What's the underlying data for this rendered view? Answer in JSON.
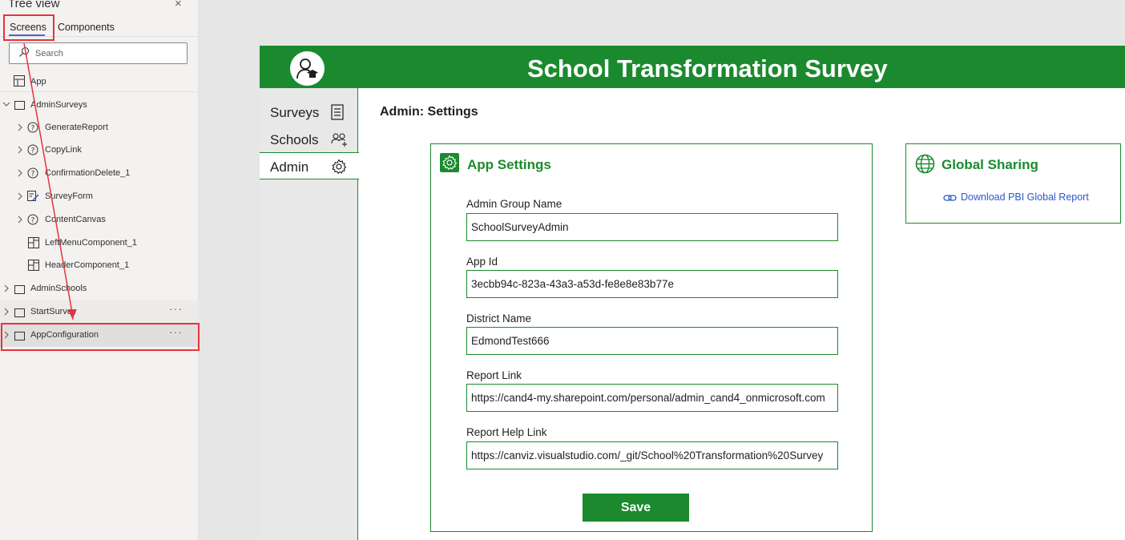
{
  "tree_view": {
    "title": "Tree view",
    "close_glyph": "×",
    "tabs": {
      "screens": "Screens",
      "components": "Components"
    },
    "search_placeholder": "Search",
    "app_item": "App",
    "items": [
      {
        "label": "AdminSurveys",
        "level": 0,
        "icon": "screen-icon"
      },
      {
        "label": "GenerateReport",
        "level": 1,
        "icon": "question-circle-icon"
      },
      {
        "label": "CopyLink",
        "level": 1,
        "icon": "question-circle-icon"
      },
      {
        "label": "ConfirmationDelete_1",
        "level": 1,
        "icon": "question-circle-icon"
      },
      {
        "label": "SurveyForm",
        "level": 1,
        "icon": "form-edit-icon"
      },
      {
        "label": "ContentCanvas",
        "level": 1,
        "icon": "question-circle-icon"
      },
      {
        "label": "LeftMenuComponent_1",
        "level": 1,
        "icon": "component-icon"
      },
      {
        "label": "HeaderComponent_1",
        "level": 1,
        "icon": "component-icon"
      },
      {
        "label": "AdminSchools",
        "level": 0,
        "icon": "screen-icon"
      },
      {
        "label": "StartSurvey",
        "level": 0,
        "icon": "screen-icon"
      },
      {
        "label": "AppConfiguration",
        "level": 0,
        "icon": "screen-icon"
      }
    ],
    "more_glyph": "···"
  },
  "app": {
    "title": "School Transformation Survey",
    "nav": [
      {
        "label": "Surveys",
        "icon": "survey-list-icon"
      },
      {
        "label": "Schools",
        "icon": "people-add-icon"
      },
      {
        "label": "Admin",
        "icon": "gear-icon",
        "active": true
      }
    ],
    "page_heading": "Admin: Settings",
    "settings_card": {
      "title": "App Settings",
      "fields": [
        {
          "label": "Admin Group Name",
          "value": "SchoolSurveyAdmin"
        },
        {
          "label": "App Id",
          "value": "3ecbb94c-823a-43a3-a53d-fe8e8e83b77e"
        },
        {
          "label": "District Name",
          "value": "EdmondTest666"
        },
        {
          "label": "Report Link",
          "value": "https://cand4-my.sharepoint.com/personal/admin_cand4_onmicrosoft.com"
        },
        {
          "label": "Report Help Link",
          "value": "https://canviz.visualstudio.com/_git/School%20Transformation%20Survey"
        }
      ],
      "save_label": "Save"
    },
    "sharing_card": {
      "title": "Global Sharing",
      "link_label": "Download PBI Global Report"
    }
  },
  "colors": {
    "brand_green": "#1b8a2e",
    "annotation_red": "#e8323c",
    "link_blue": "#2b57c6"
  }
}
